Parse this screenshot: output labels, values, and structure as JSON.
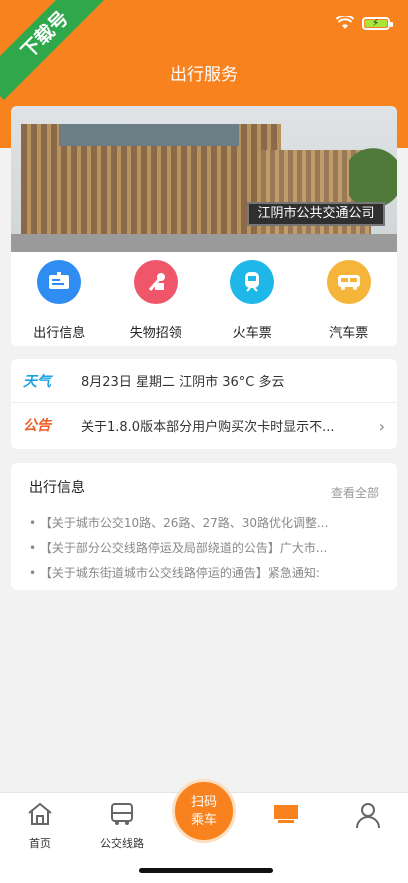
{
  "watermark": "下载号",
  "header": {
    "title": "出行服务"
  },
  "banner": {
    "sign": "江阴市公共交通公司"
  },
  "quick_links": [
    {
      "label": "出行信息",
      "icon": "info-board-icon",
      "color": "#2f8cf0"
    },
    {
      "label": "失物招领",
      "icon": "lost-found-icon",
      "color": "#f0566a"
    },
    {
      "label": "火车票",
      "icon": "train-icon",
      "color": "#1fb6e8"
    },
    {
      "label": "汽车票",
      "icon": "bus-icon",
      "color": "#f5b43a"
    }
  ],
  "notice": {
    "weather_tag": "天气",
    "weather_text": "8月23日 星期二 江阴市 36°C 多云",
    "announce_tag": "公告",
    "announce_text": "关于1.8.0版本部分用户购买次卡时显示不..."
  },
  "news": {
    "title": "出行信息",
    "more": "查看全部",
    "items": [
      "【关于城市公交10路、26路、27路、30路优化调整...",
      "【关于部分公交线路停运及局部绕道的公告】广大市...",
      "【关于城东街道城市公交线路停运的通告】紧急通知:"
    ]
  },
  "tabbar": {
    "home": "首页",
    "routes": "公交线路",
    "scan": "扫码乘车"
  },
  "colors": {
    "accent": "#f7821e",
    "weather": "#1aa3e0",
    "announce": "#f05a24"
  }
}
